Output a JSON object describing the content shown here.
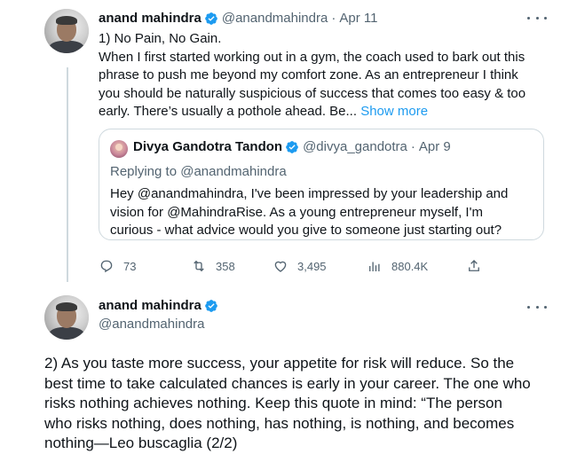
{
  "tweet1": {
    "author_name": "anand mahindra",
    "handle": "@anandmahindra",
    "separator": "·",
    "date": "Apr 11",
    "text_lines": [
      "1) No Pain, No Gain.",
      "When I first started working out in a gym, the coach used to bark out this",
      "phrase to push me beyond my comfort zone. As an entrepreneur I think",
      "you should be naturally suspicious of success that comes too easy & too",
      "early. There’s usually a pothole ahead. Be..."
    ],
    "show_more": "Show more",
    "quote": {
      "author_name": "Divya Gandotra Tandon",
      "handle": "@divya_gandotra",
      "separator": "·",
      "date": "Apr 9",
      "replying_to": "Replying to @anandmahindra",
      "text_lines": [
        "Hey @anandmahindra, I've been impressed by your leadership and",
        "vision for @MahindraRise. As a young entrepreneur myself, I'm",
        "curious - what advice would you give to someone just starting out?"
      ]
    },
    "actions": {
      "replies": "73",
      "retweets": "358",
      "likes": "3,495",
      "views": "880.4K"
    }
  },
  "tweet2": {
    "author_name": "anand mahindra",
    "handle": "@anandmahindra",
    "text_lines": [
      "2) As you taste more success, your appetite for risk will reduce. So the",
      "best time to take calculated chances is early in your career.  The one who",
      "risks nothing achieves nothing.  Keep this quote in mind: “The person",
      "who risks nothing, does nothing, has nothing, is nothing, and becomes",
      "nothing—Leo buscaglia (2/2)"
    ]
  },
  "colors": {
    "text": "#0f1419",
    "muted": "#536471",
    "link": "#1d9bf0",
    "verified": "#1d9bf0",
    "border": "#cfd9de"
  },
  "icons": [
    "verified-badge-icon",
    "more-options-icon",
    "reply-icon",
    "retweet-icon",
    "like-icon",
    "views-icon",
    "share-icon"
  ]
}
